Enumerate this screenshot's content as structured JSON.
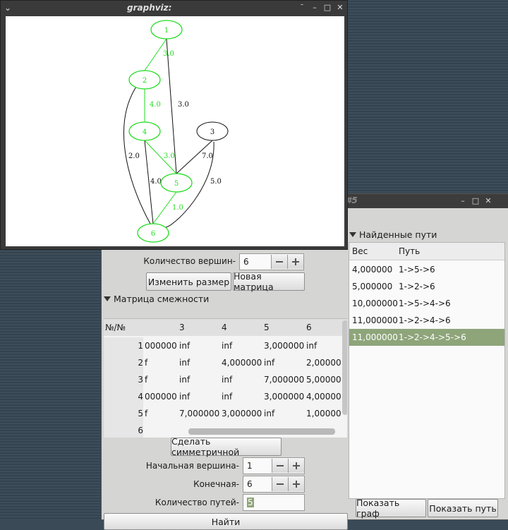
{
  "graph_window": {
    "title": "graphviz:",
    "nodes": [
      {
        "label": "1",
        "highlight": true
      },
      {
        "label": "2",
        "highlight": true
      },
      {
        "label": "3",
        "highlight": false
      },
      {
        "label": "4",
        "highlight": true
      },
      {
        "label": "5",
        "highlight": true
      },
      {
        "label": "6",
        "highlight": true
      }
    ],
    "edges": [
      {
        "from": "1",
        "to": "2",
        "label": "3.0",
        "highlight": true
      },
      {
        "from": "1",
        "to": "5",
        "label": "3.0",
        "highlight": false
      },
      {
        "from": "2",
        "to": "4",
        "label": "4.0",
        "highlight": true
      },
      {
        "from": "2",
        "to": "6",
        "label": "2.0",
        "highlight": false
      },
      {
        "from": "4",
        "to": "5",
        "label": "3.0",
        "highlight": true
      },
      {
        "from": "4",
        "to": "6",
        "label": "4.0",
        "highlight": false
      },
      {
        "from": "3",
        "to": "5",
        "label": "7.0",
        "highlight": false
      },
      {
        "from": "3",
        "to": "6",
        "label": "5.0",
        "highlight": false
      },
      {
        "from": "5",
        "to": "6",
        "label": "1.0",
        "highlight": true
      }
    ],
    "colors": {
      "highlight": "#22dd22",
      "normal": "#111111"
    }
  },
  "main_window": {
    "title_fragment": "#5",
    "vertex_count_label": "Количество вершин-",
    "vertex_count_value": "6",
    "resize_button": "Изменить размер",
    "new_matrix_button": "Новая матрица",
    "matrix_section": "Матрица смежности",
    "matrix": {
      "corner": "№/№",
      "columns": [
        "3",
        "4",
        "5",
        "6"
      ],
      "rows": [
        {
          "num": "1",
          "cells": [
            "000000",
            "inf",
            "inf",
            "3,000000",
            "inf"
          ]
        },
        {
          "num": "2",
          "cells": [
            "f",
            "inf",
            "4,000000",
            "inf",
            "2,00000"
          ]
        },
        {
          "num": "3",
          "cells": [
            "f",
            "inf",
            "inf",
            "7,000000",
            "5,00000"
          ]
        },
        {
          "num": "4",
          "cells": [
            "000000",
            "inf",
            "inf",
            "3,000000",
            "4,00000"
          ]
        },
        {
          "num": "5",
          "cells": [
            "f",
            "7,000000",
            "3,000000",
            "inf",
            "1,00000"
          ]
        },
        {
          "num": "6",
          "cells": [
            "",
            "",
            "",
            "",
            ""
          ]
        }
      ]
    },
    "symmetric_button": "Сделать симметричной",
    "start_vertex_label": "Начальная вершина-",
    "start_vertex_value": "1",
    "end_vertex_label": "Конечная-",
    "end_vertex_value": "6",
    "path_count_label": "Количество путей-",
    "path_count_value": "5",
    "find_button": "Найти",
    "found_paths_section": "Найденные пути",
    "paths_columns": {
      "weight": "Вес",
      "path": "Путь"
    },
    "paths": [
      {
        "weight": "4,000000",
        "path": "1->5->6",
        "selected": false
      },
      {
        "weight": "5,000000",
        "path": "1->2->6",
        "selected": false
      },
      {
        "weight": "10,000000",
        "path": "1->5->4->6",
        "selected": false
      },
      {
        "weight": "11,000000",
        "path": "1->2->4->6",
        "selected": false
      },
      {
        "weight": "11,000000",
        "path": "1->2->4->5->6",
        "selected": true
      }
    ],
    "show_graph_button": "Показать граф",
    "show_path_button": "Показать путь"
  }
}
